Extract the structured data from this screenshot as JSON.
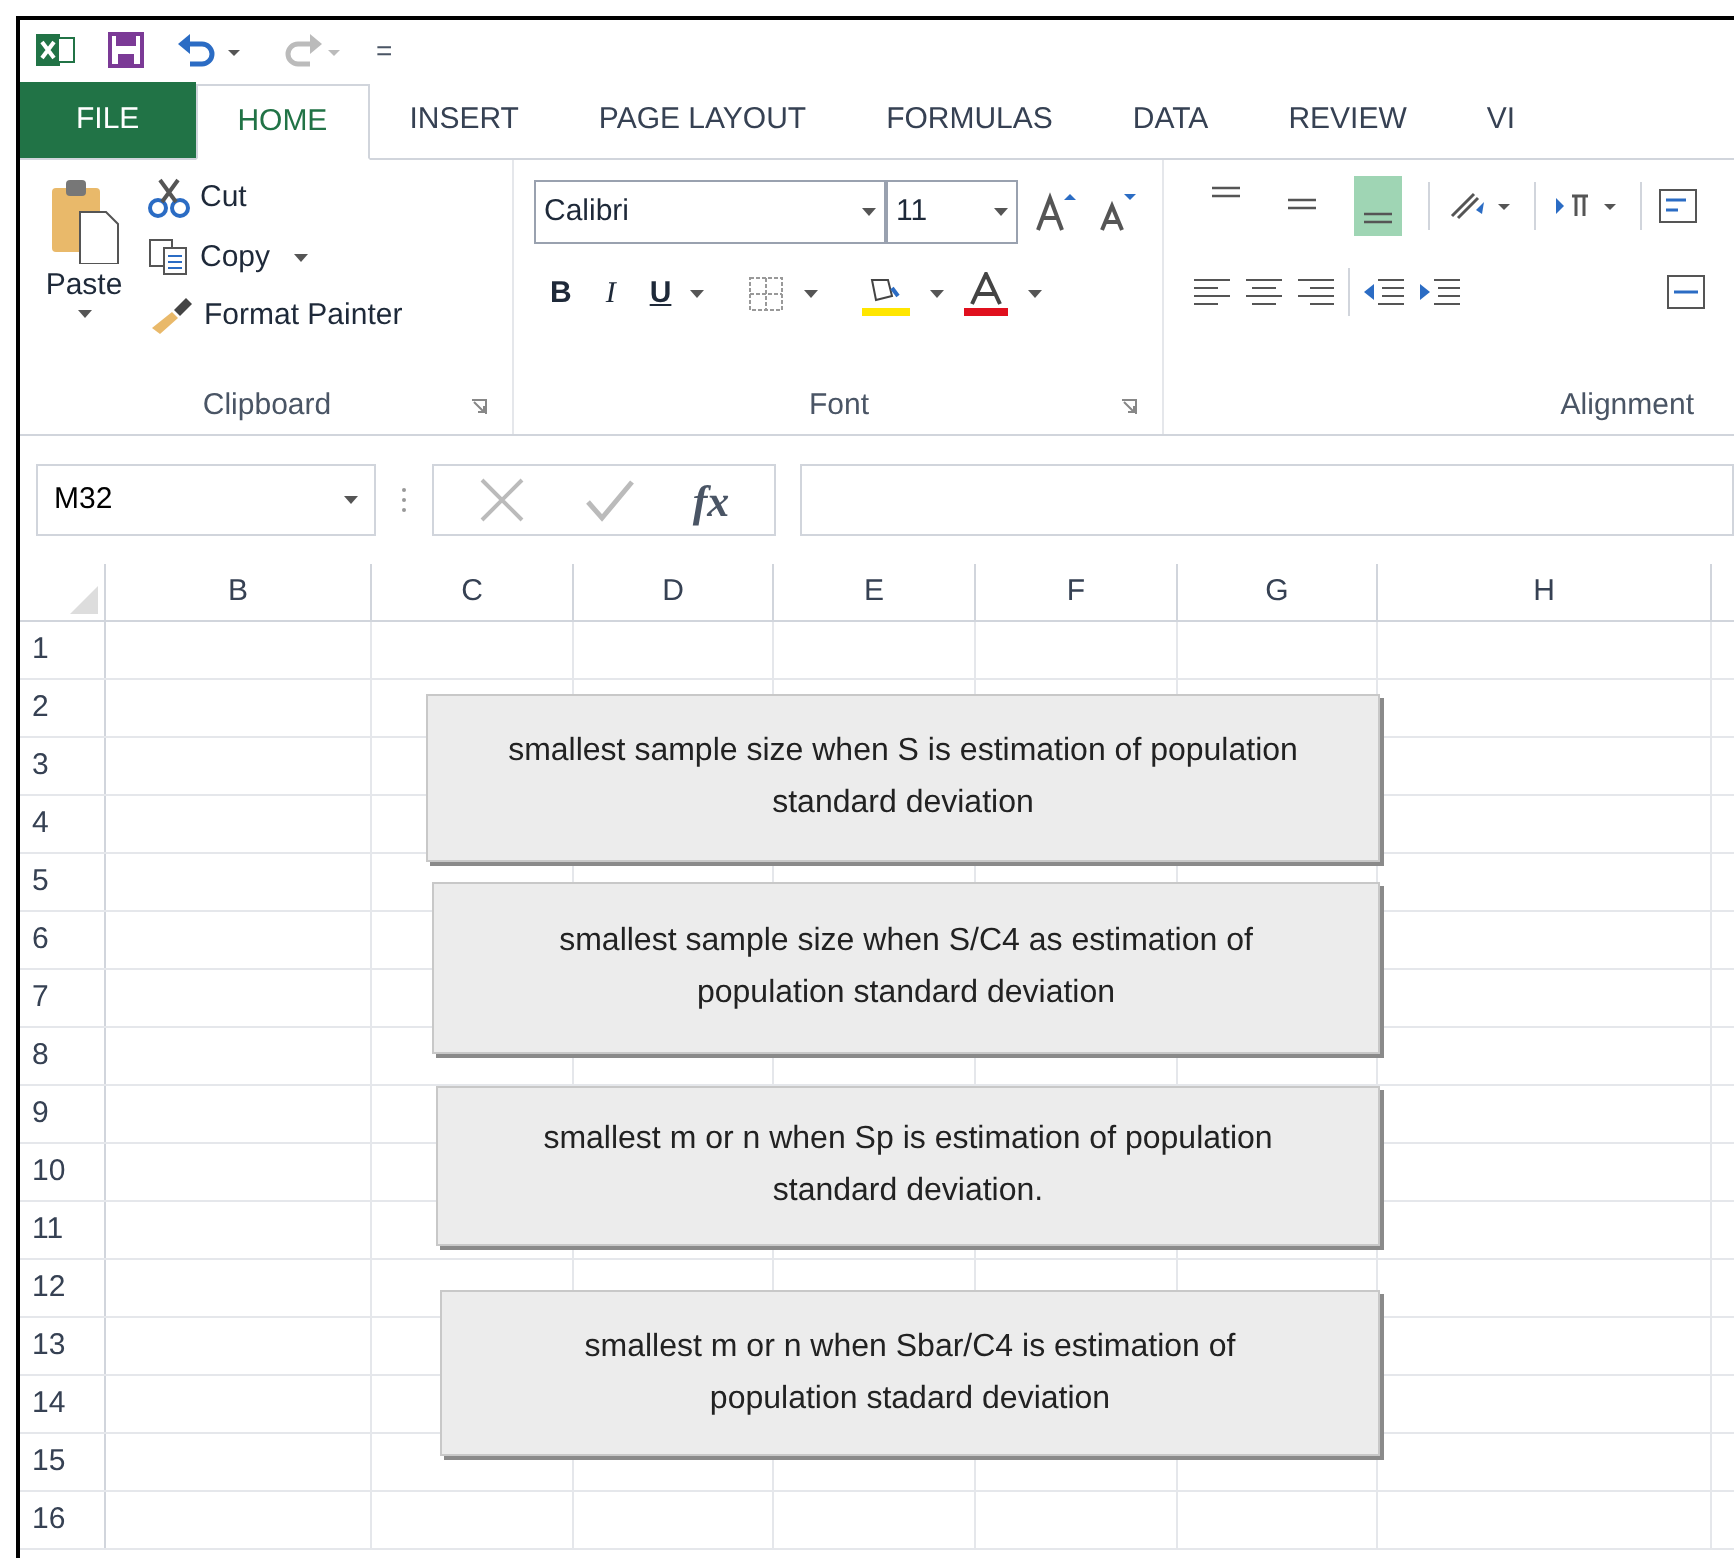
{
  "quick_access": {
    "customize": "="
  },
  "tabs": [
    {
      "label": "FILE",
      "kind": "file",
      "selected": false
    },
    {
      "label": "HOME",
      "kind": "tab",
      "selected": true
    },
    {
      "label": "INSERT",
      "kind": "tab",
      "selected": false
    },
    {
      "label": "PAGE LAYOUT",
      "kind": "tab",
      "selected": false
    },
    {
      "label": "FORMULAS",
      "kind": "tab",
      "selected": false
    },
    {
      "label": "DATA",
      "kind": "tab",
      "selected": false
    },
    {
      "label": "REVIEW",
      "kind": "tab",
      "selected": false
    },
    {
      "label": "VI",
      "kind": "tab",
      "selected": false
    }
  ],
  "ribbon": {
    "clipboard": {
      "paste": "Paste",
      "cut": "Cut",
      "copy": "Copy",
      "format_painter": "Format Painter",
      "label": "Clipboard"
    },
    "font": {
      "font_name": "Calibri",
      "font_size": "11",
      "bold": "B",
      "italic": "I",
      "underline": "U",
      "label": "Font"
    },
    "alignment": {
      "vertical": [
        {
          "selected": false
        },
        {
          "selected": false
        },
        {
          "selected": true
        }
      ],
      "label": "Alignment"
    }
  },
  "formula_bar": {
    "name_box": "M32",
    "fx": "fx"
  },
  "columns": [
    "B",
    "C",
    "D",
    "E",
    "F",
    "G",
    "H"
  ],
  "rows": [
    "1",
    "2",
    "3",
    "4",
    "5",
    "6",
    "7",
    "8",
    "9",
    "10",
    "11",
    "12",
    "13",
    "14",
    "15",
    "16"
  ],
  "buttons": [
    "smallest sample size when S is estimation of population standard deviation",
    "smallest sample size when S/C4 as estimation of population standard deviation",
    "smallest m or n when Sp is estimation of population standard deviation.",
    "smallest m or n when Sbar/C4 is estimation of population stadard deviation"
  ]
}
